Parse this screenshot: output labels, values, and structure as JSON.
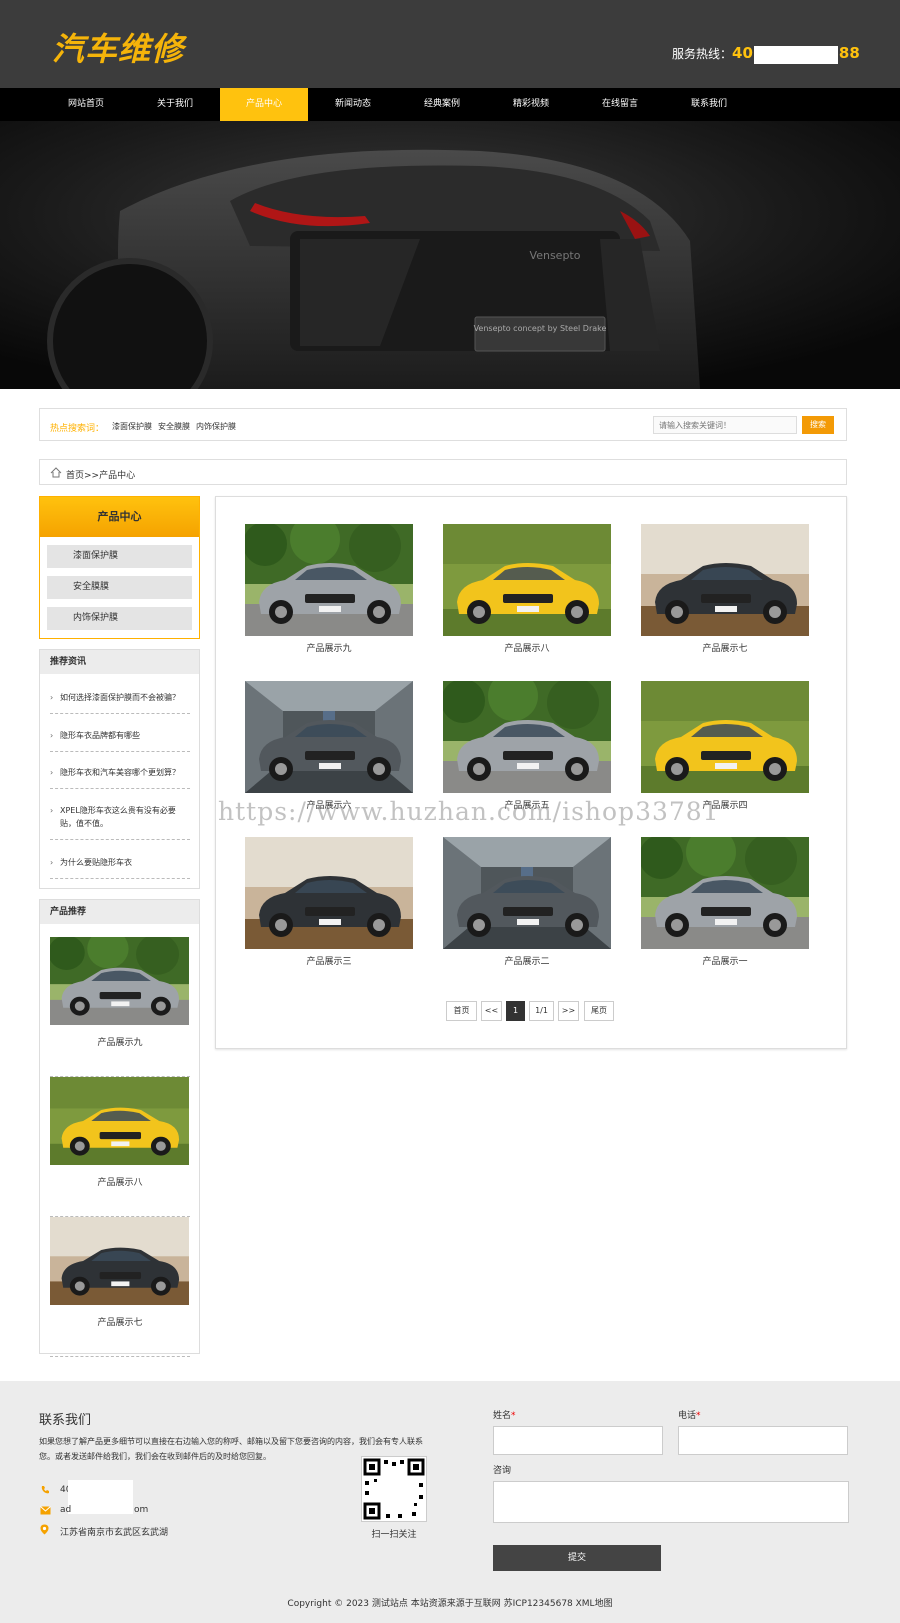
{
  "header": {
    "logo": "汽车维修",
    "hotline_label": "服务热线：",
    "hotline_prefix": "40",
    "hotline_suffix": "88"
  },
  "nav": {
    "items": [
      "网站首页",
      "关于我们",
      "产品中心",
      "新闻动态",
      "经典案例",
      "精彩视频",
      "在线留言",
      "联系我们"
    ],
    "active": "产品中心"
  },
  "banner": {
    "brand": "Vensepto",
    "plate": "Vensepto concept by Steel Drake"
  },
  "search": {
    "hot_label": "热点搜索词：",
    "keywords": [
      "漆面保护膜",
      "安全膜膜",
      "内饰保护膜"
    ],
    "placeholder": "请输入搜索关键词！",
    "button": "搜索"
  },
  "breadcrumb": {
    "text": "首页>>产品中心"
  },
  "sidebar": {
    "category_title": "产品中心",
    "categories": [
      "漆面保护膜",
      "安全膜膜",
      "内饰保护膜"
    ],
    "news_title": "推荐资讯",
    "news": [
      "如何选择漆面保护膜而不会被骗？",
      "隐形车衣品牌都有哪些",
      "隐形车衣和汽车美容哪个更划算？",
      "XPEL隐形车衣这么贵有没有必要贴，值不值。",
      "为什么要贴隐形车衣"
    ],
    "products_title": "产品推荐",
    "products": [
      "产品展示九",
      "产品展示八",
      "产品展示七"
    ]
  },
  "products": [
    {
      "name": "产品展示九",
      "car": "silver-amg",
      "bg": "forest"
    },
    {
      "name": "产品展示八",
      "car": "yellow-lambo",
      "bg": "grass"
    },
    {
      "name": "产品展示七",
      "car": "black-audi",
      "bg": "dust"
    },
    {
      "name": "产品展示六",
      "car": "gray-maserati",
      "bg": "room"
    },
    {
      "name": "产品展示五",
      "car": "silver-amg",
      "bg": "forest"
    },
    {
      "name": "产品展示四",
      "car": "yellow-lambo",
      "bg": "grass"
    },
    {
      "name": "产品展示三",
      "car": "black-audi",
      "bg": "dust"
    },
    {
      "name": "产品展示二",
      "car": "gray-maserati",
      "bg": "room"
    },
    {
      "name": "产品展示一",
      "car": "silver-amg",
      "bg": "forest"
    }
  ],
  "pagination": {
    "first": "首页",
    "prev": "<<",
    "current": "1",
    "total": "1/1",
    "next": ">>",
    "last": "尾页"
  },
  "watermark": "https://www.huzhan.com/ishop33781",
  "footer": {
    "contact_title": "联系我们",
    "description": "如果您想了解产品更多细节可以直接在右边输入您的称呼、邮箱以及留下您要咨询的内容，我们会有专人联系您。或者发送邮件给我们，我们会在收到邮件后的及时给您回复。",
    "phone_prefix": "40",
    "email_prefix": "ad",
    "email_suffix": "om",
    "address": "江苏省南京市玄武区玄武湖",
    "qr_caption": "扫一扫关注",
    "form": {
      "name_label": "姓名",
      "phone_label": "电话",
      "required_mark": "*",
      "message_label": "咨询",
      "submit": "提交"
    },
    "copyright": "Copyright © 2023 测试站点 本站资源来源于互联网 苏ICP12345678 XML地图"
  },
  "colors": {
    "accent": "#ffc20e",
    "header_bg": "#3c3c3c",
    "nav_bg": "#000000",
    "search_button": "#f39a06",
    "footer_bg": "#ececec"
  }
}
